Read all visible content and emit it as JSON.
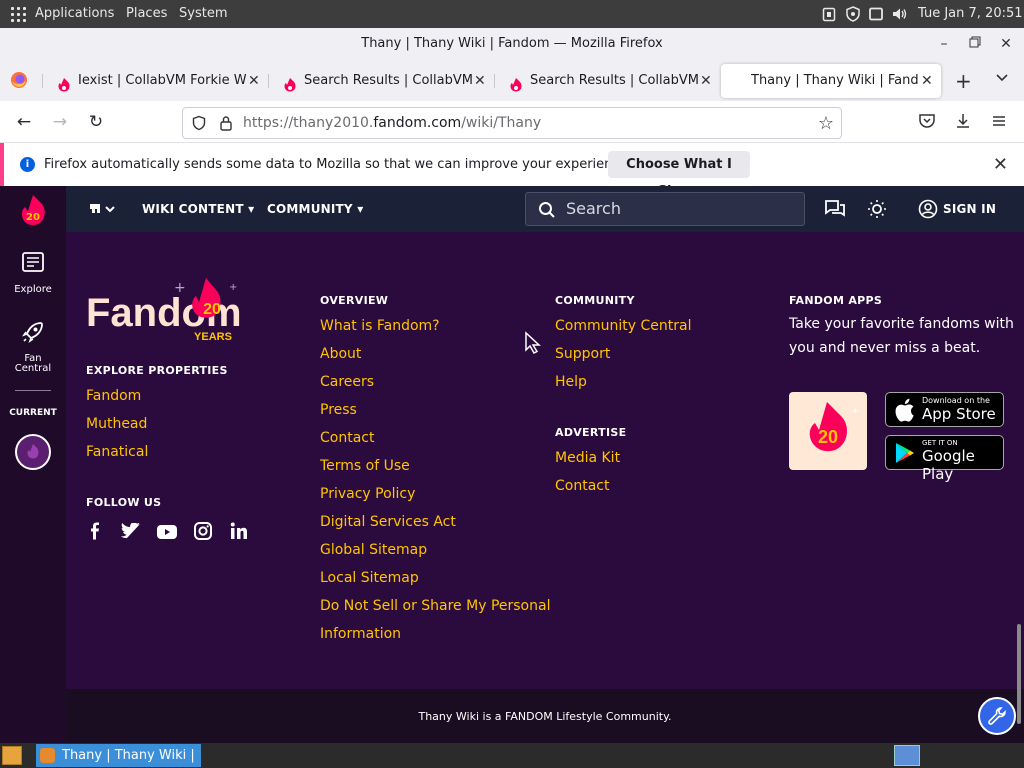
{
  "panel": {
    "applications": "Applications",
    "places": "Places",
    "system": "System",
    "clock": "Tue Jan  7, 20:51"
  },
  "window": {
    "title": "Thany | Thany Wiki | Fandom — Mozilla Firefox"
  },
  "tabs": [
    {
      "label": "Iexist | CollabVM Forkie Wiki"
    },
    {
      "label": "Search Results | CollabVM Forkie Wiki"
    },
    {
      "label": "Search Results | CollabVM Forkie Wiki"
    },
    {
      "label": "Thany | Thany Wiki | Fandom"
    }
  ],
  "urlbar": {
    "prefix": "https://thany2010.",
    "domain": "fandom.com",
    "path": "/wiki/Thany"
  },
  "notification": {
    "message": "Firefox automatically sends some data to Mozilla so that we can improve your experience.",
    "button": "Choose What I Share"
  },
  "fandom_nav": {
    "wiki_content": "WIKI CONTENT",
    "community": "COMMUNITY",
    "search_placeholder": "Search",
    "sign_in": "SIGN IN"
  },
  "rail": {
    "explore": "Explore",
    "fan_central_1": "Fan",
    "fan_central_2": "Central",
    "current": "CURRENT",
    "badge": "20"
  },
  "footer": {
    "logo_text": "Fandom",
    "logo_badge": "20",
    "logo_years": "YEARS",
    "explore_heading": "EXPLORE PROPERTIES",
    "explore_links": [
      "Fandom",
      "Muthead",
      "Fanatical"
    ],
    "follow_heading": "FOLLOW US",
    "social_icons": [
      "facebook-icon",
      "twitter-icon",
      "youtube-icon",
      "instagram-icon",
      "linkedin-icon"
    ],
    "overview_heading": "OVERVIEW",
    "overview_links": [
      "What is Fandom?",
      "About",
      "Careers",
      "Press",
      "Contact",
      "Terms of Use",
      "Privacy Policy",
      "Digital Services Act",
      "Global Sitemap",
      "Local Sitemap",
      "Do Not Sell or Share My Personal",
      "Information"
    ],
    "community_heading": "COMMUNITY",
    "community_links": [
      "Community Central",
      "Support",
      "Help"
    ],
    "advertise_heading": "ADVERTISE",
    "advertise_links": [
      "Media Kit",
      "Contact"
    ],
    "apps_heading": "FANDOM APPS",
    "apps_text_1": "Take your favorite fandoms with",
    "apps_text_2": "you and never miss a beat.",
    "app_badge": "20",
    "appstore_small": "Download on the",
    "appstore_big": "App Store",
    "googleplay_small": "GET IT ON",
    "googleplay_big": "Google Play",
    "credit": "Thany Wiki is a FANDOM Lifestyle Community."
  },
  "taskbar": {
    "task_label": "Thany | Thany Wiki | ..."
  },
  "colors": {
    "accent_pink": "#fa005a",
    "link_yellow": "#ffc500",
    "page_bg": "#2b0a3d"
  }
}
